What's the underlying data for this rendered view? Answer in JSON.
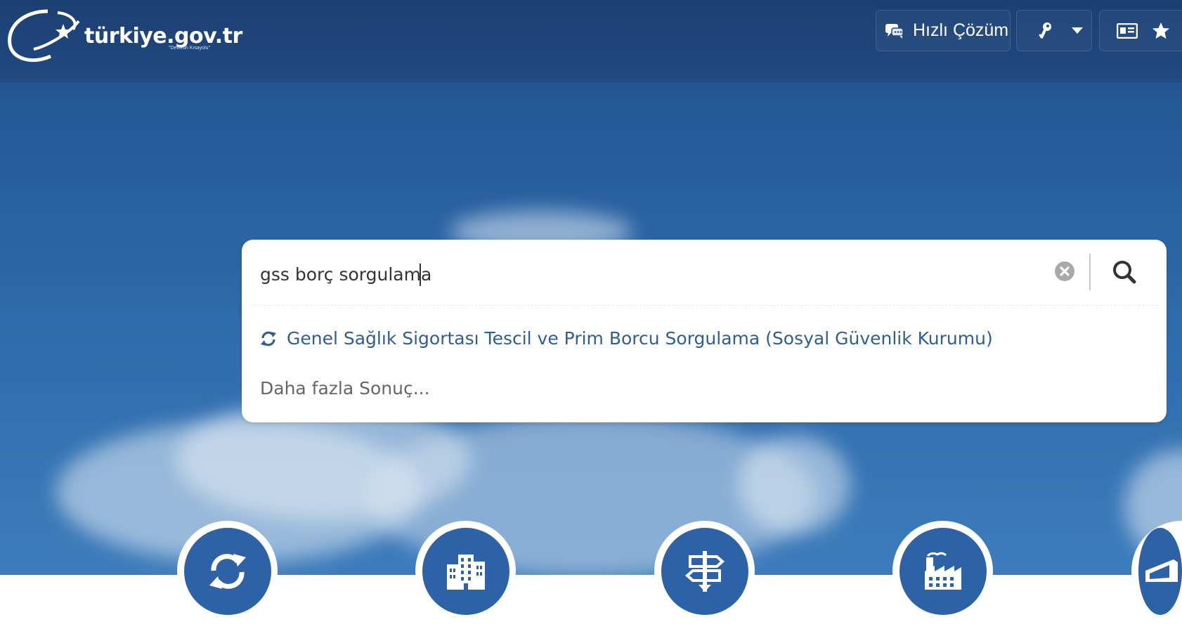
{
  "header": {
    "logo_text": "türkiye.gov.tr",
    "logo_tagline": "\"Devletin Kısayolu\"",
    "quick_solution_label": "Hızlı Çözüm"
  },
  "search": {
    "value": "gss borç sorgulama",
    "placeholder": ""
  },
  "results": {
    "items": [
      {
        "label": "Genel Sağlık Sigortası Tescil ve Prim Borcu Sorgulama (Sosyal Güvenlik Kurumu)",
        "icon": "refresh-icon"
      }
    ],
    "more_label": "Daha fazla Sonuç..."
  },
  "categories": [
    {
      "icon": "refresh-icon"
    },
    {
      "icon": "building-icon"
    },
    {
      "icon": "signpost-icon"
    },
    {
      "icon": "factory-icon"
    },
    {
      "icon": "graduation-cap-icon"
    }
  ],
  "colors": {
    "header_bg": "#1c3f72",
    "accent_blue": "#2e62a7",
    "result_link": "#2f5e93"
  }
}
